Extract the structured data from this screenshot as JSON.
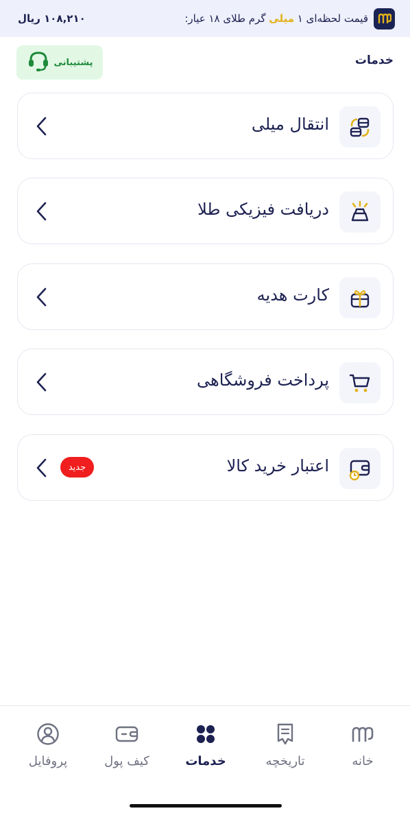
{
  "topbar": {
    "ticker_prefix": "قیمت لحظه‌ای ۱",
    "ticker_highlight": "میلی",
    "ticker_suffix": "گرم طلای ۱۸ عیار:",
    "price": "۱۰۸,۲۱۰ ریال",
    "logo_letter": "m"
  },
  "header": {
    "title": "خدمات",
    "support_label": "پشتیبانی"
  },
  "services": [
    {
      "label": "انتقال میلی",
      "icon": "transfer-icon"
    },
    {
      "label": "دریافت فیزیکی طلا",
      "icon": "gold-bar-icon"
    },
    {
      "label": "کارت هدیه",
      "icon": "gift-icon"
    },
    {
      "label": "پرداخت فروشگاهی",
      "icon": "cart-icon"
    },
    {
      "label": "اعتبار خرید کالا",
      "icon": "credit-wallet-icon",
      "badge": "جدید"
    }
  ],
  "nav": {
    "home": "خانه",
    "history": "تاریخچه",
    "services": "خدمات",
    "wallet": "کیف پول",
    "profile": "پروفایل",
    "active": "services"
  },
  "colors": {
    "primary": "#1d2151",
    "accent_gold": "#e2b21c",
    "support_green": "#1f8a3a",
    "badge_red": "#f01e1e"
  }
}
